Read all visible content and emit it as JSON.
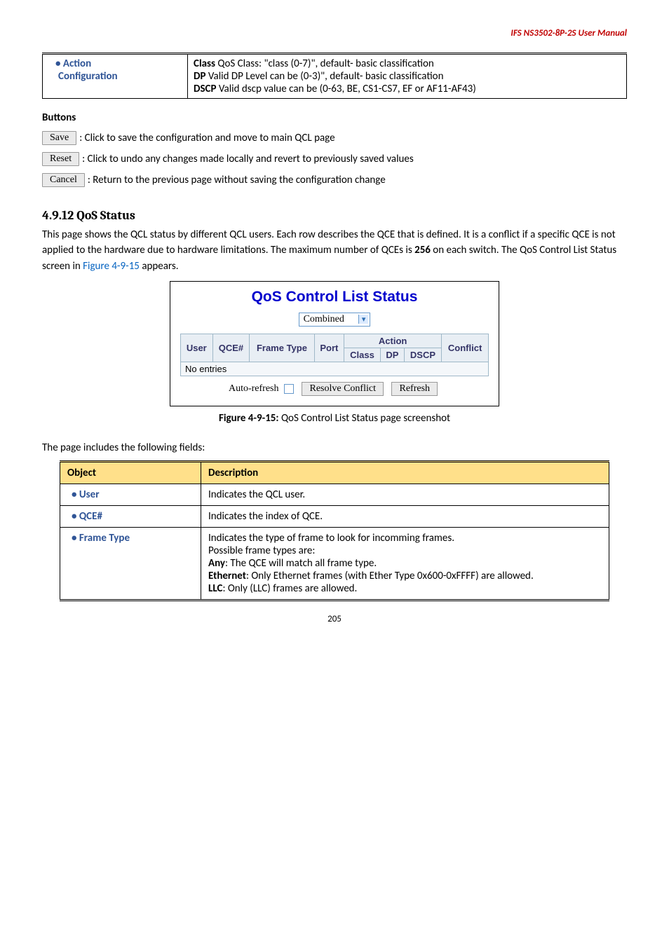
{
  "header": {
    "running": "IFS  NS3502-8P-2S  User  Manual"
  },
  "top_table": {
    "left1": "Action",
    "left2": "Configuration",
    "r1_strong": "Class",
    "r1_rest": " QoS Class: \"class (0-7)\", default- basic classification",
    "r2_strong": "DP",
    "r2_rest": " Valid DP Level can be (0-3)\", default- basic classification",
    "r3_strong": "DSCP",
    "r3_rest": " Valid dscp value can be (0-63, BE, CS1-CS7, EF or AF11-AF43)"
  },
  "buttons_section": {
    "heading": "Buttons",
    "save_btn": "Save",
    "save_txt": ": Click to save the configuration and move to main QCL page",
    "reset_btn": "Reset",
    "reset_txt": ": Click to undo any changes made locally and revert to previously saved values",
    "cancel_btn": "Cancel",
    "cancel_txt": ": Return to the previous page without saving the configuration change"
  },
  "sec_title": "4.9.12 QoS Status",
  "sec_body_pre": "This page shows the QCL status by different QCL users. Each row describes the QCE that is defined. It is a conflict if a specific QCE is not applied to the hardware due to hardware limitations. The maximum number of QCEs is ",
  "sec_body_bold": "256",
  "sec_body_mid": " on each switch. The QoS Control List Status screen in ",
  "sec_body_link": "Figure 4-9-15",
  "sec_body_post": " appears.",
  "qcl": {
    "title": "QoS Control List Status",
    "select": "Combined",
    "th_user": "User",
    "th_qce": "QCE#",
    "th_ft": "Frame Type",
    "th_port": "Port",
    "th_action": "Action",
    "th_class": "Class",
    "th_dp": "DP",
    "th_dscp": "DSCP",
    "th_conf": "Conflict",
    "noent": "No entries",
    "autorefresh": "Auto-refresh",
    "resolve": "Resolve Conflict",
    "refresh": "Refresh"
  },
  "fig_caption_b": "Figure 4-9-15:",
  "fig_caption_r": " QoS Control List Status page screenshot",
  "fields_intro": "The page includes the following fields:",
  "desc_table": {
    "h1": "Object",
    "h2": "Description",
    "rows": [
      {
        "obj": "User",
        "desc_plain": "Indicates the QCL user."
      },
      {
        "obj": "QCE#",
        "desc_plain": "Indicates the index of QCE."
      }
    ],
    "ft_obj": "Frame Type",
    "ft_l1": "Indicates the type of frame to look for incomming frames.",
    "ft_l2": "Possible frame types are:",
    "ft_l3b": "Any",
    "ft_l3r": ": The QCE will match all frame type.",
    "ft_l4b": "Ethernet",
    "ft_l4r": ": Only Ethernet frames (with Ether Type 0x600-0xFFFF) are allowed.",
    "ft_l5b": "LLC",
    "ft_l5r": ": Only (LLC) frames are allowed."
  },
  "page_no": "205"
}
